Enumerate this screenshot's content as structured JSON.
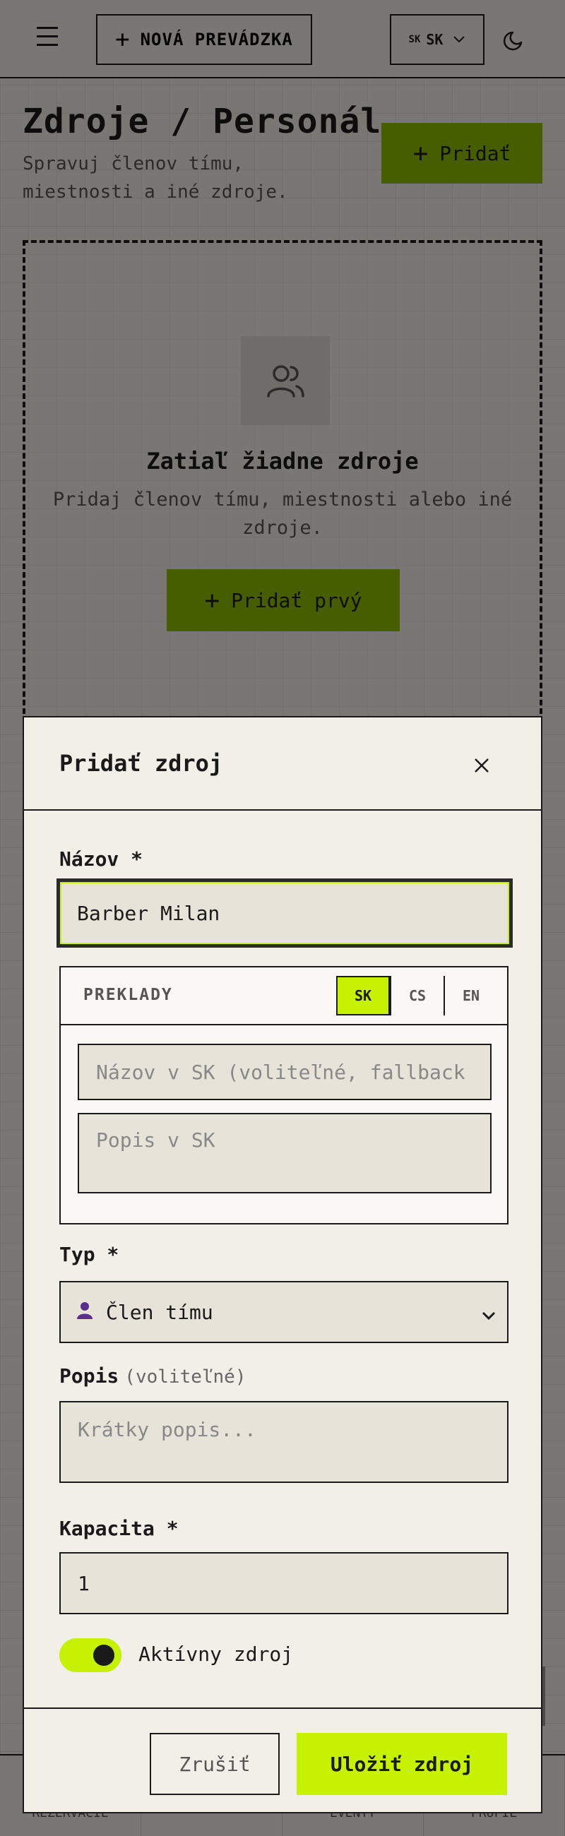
{
  "topbar": {
    "new_store_label": "NOVÁ PREVÁDZKA",
    "lang_flag": "SK",
    "lang_value": "SK"
  },
  "page": {
    "title": "Zdroje / Personál",
    "subtitle": "Spravuj členov tímu, miestnosti a iné zdroje.",
    "add_label": "Pridať"
  },
  "empty_state": {
    "title": "Zatiaľ žiadne zdroje",
    "text": "Pridaj členov tímu, miestnosti alebo iné zdroje.",
    "button_label": "Pridať prvý"
  },
  "bottom_nav": {
    "items": [
      "REZERVÁCIE",
      "",
      "EVENTY",
      "PROFIL"
    ]
  },
  "modal": {
    "title": "Pridať zdroj",
    "name_label": "Názov *",
    "name_value": "Barber Milan",
    "translations": {
      "label": "PREKLADY",
      "tabs": [
        "SK",
        "CS",
        "EN"
      ],
      "active_tab": "SK",
      "name_placeholder": "Názov v SK (voliteľné, fallback",
      "desc_placeholder": "Popis v SK"
    },
    "type_label": "Typ *",
    "type_value": "Člen tímu",
    "desc_label": "Popis",
    "desc_optional": "(voliteľné)",
    "desc_placeholder": "Krátky popis...",
    "capacity_label": "Kapacita *",
    "capacity_value": "1",
    "active_label": "Aktívny zdroj",
    "active": true,
    "cancel_label": "Zrušiť",
    "save_label": "Uložiť zdroj"
  },
  "colors": {
    "accent": "#c6f100",
    "accent_dark": "#8cba00",
    "background": "#f2efe8"
  }
}
